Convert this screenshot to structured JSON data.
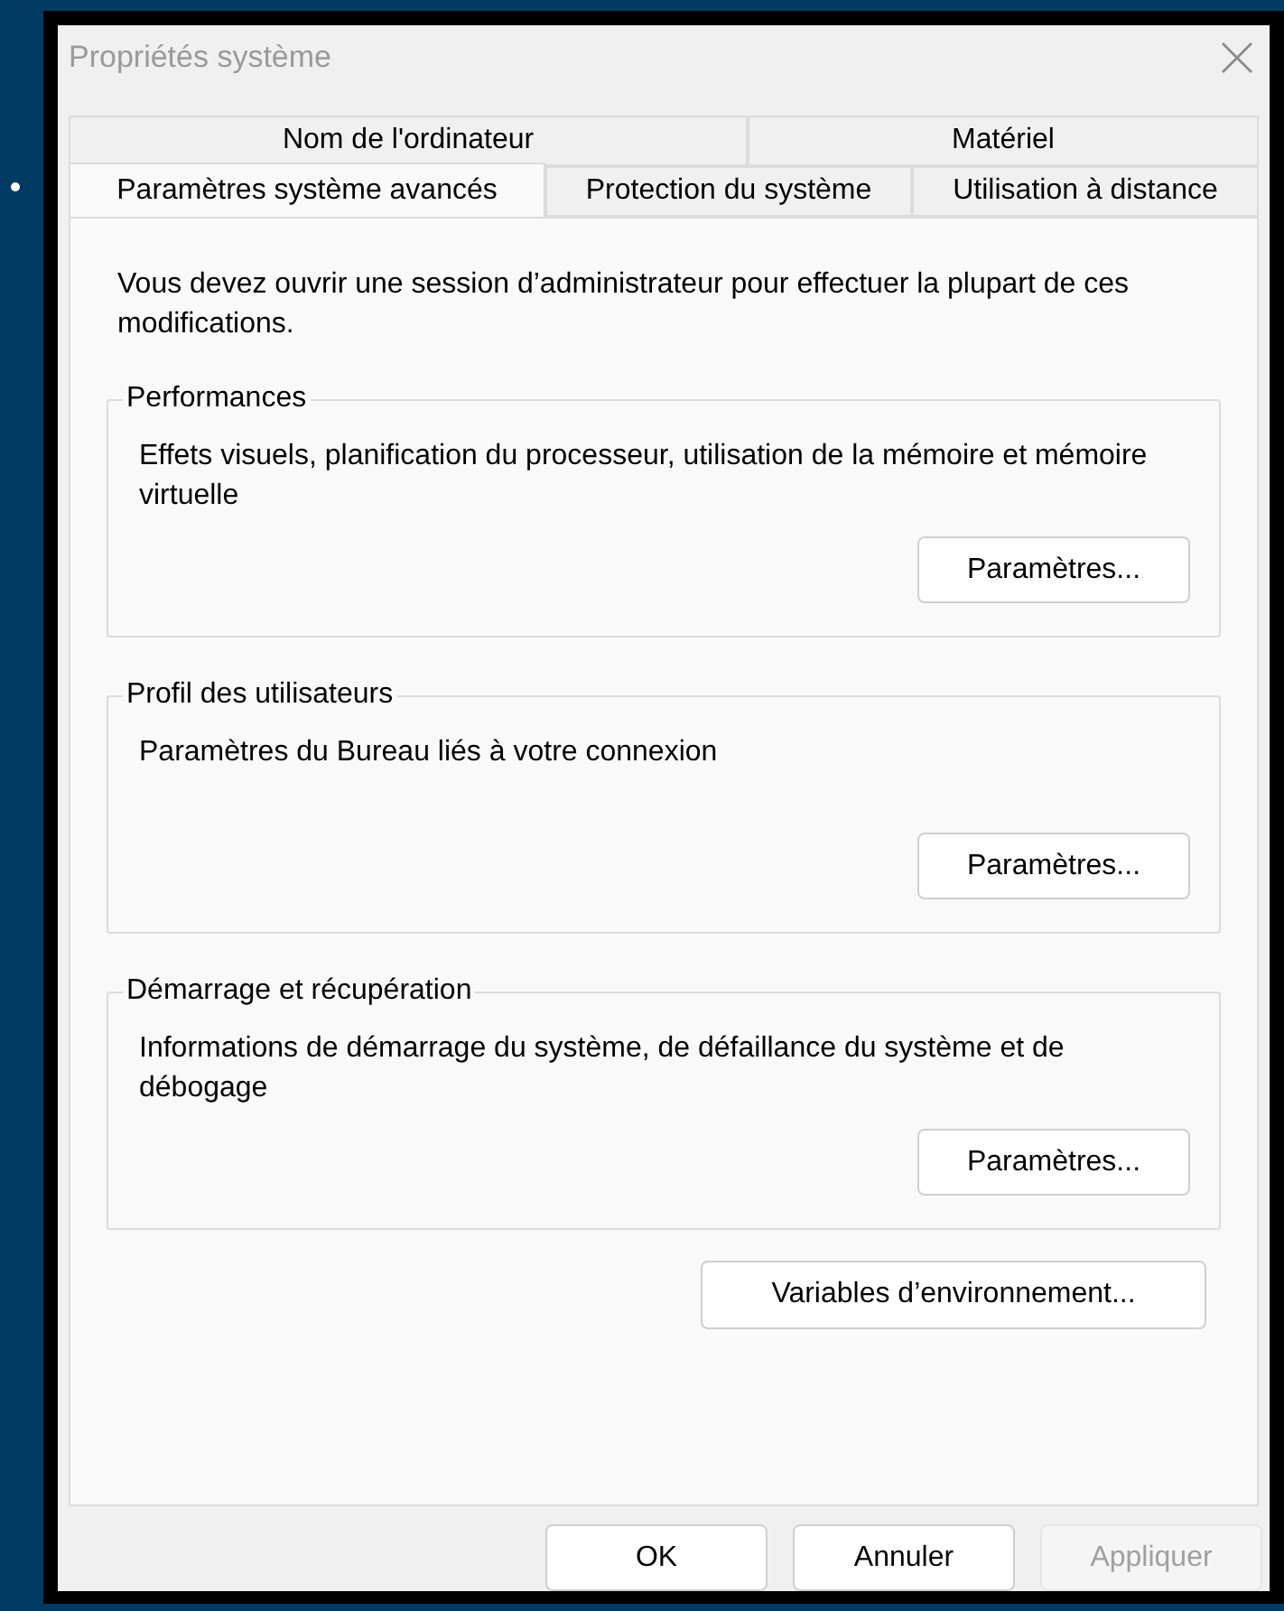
{
  "window": {
    "title": "Propriétés système"
  },
  "tab_rows": [
    {
      "tabs": [
        {
          "label": "Nom de l'ordinateur",
          "selected": false
        },
        {
          "label": "Matériel",
          "selected": false
        }
      ]
    },
    {
      "tabs": [
        {
          "label": "Paramètres système avancés",
          "selected": true
        },
        {
          "label": "Protection du système",
          "selected": false
        },
        {
          "label": "Utilisation à distance",
          "selected": false
        }
      ]
    }
  ],
  "intro": "Vous devez ouvrir une session d’administrateur pour effectuer la plupart de ces modifications.",
  "groups": [
    {
      "title": "Performances",
      "description": "Effets visuels, planification du processeur, utilisation de la mémoire et mémoire virtuelle",
      "button": "Paramètres..."
    },
    {
      "title": "Profil des utilisateurs",
      "description": "Paramètres du Bureau liés à votre connexion",
      "button": "Paramètres..."
    },
    {
      "title": "Démarrage et récupération",
      "description": "Informations de démarrage du système, de défaillance du système et de débogage",
      "button": "Paramètres..."
    }
  ],
  "env_button": "Variables d’environnement...",
  "footer_buttons": [
    {
      "label": "OK",
      "disabled": false
    },
    {
      "label": "Annuler",
      "disabled": false
    },
    {
      "label": "Appliquer",
      "disabled": true
    }
  ]
}
